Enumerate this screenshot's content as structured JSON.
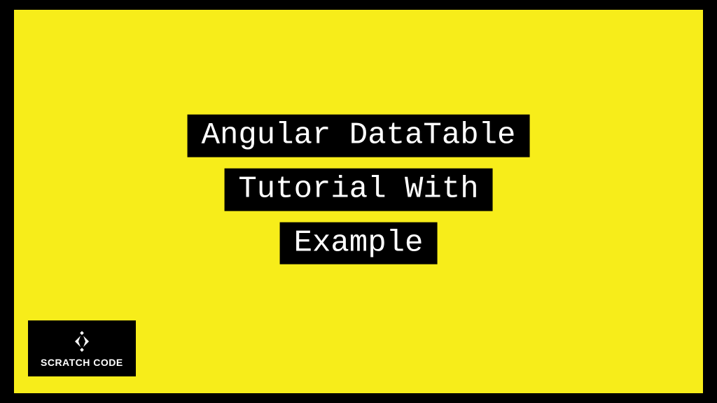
{
  "title": {
    "line1": "Angular DataTable",
    "line2": "Tutorial With",
    "line3": "Example"
  },
  "logo": {
    "brand": "SCRATCH CODE",
    "icon_name": "code-diamond-icon"
  },
  "colors": {
    "background": "#f7ed1a",
    "frame": "#000000",
    "text_bg": "#000000",
    "text_fg": "#ffffff"
  }
}
